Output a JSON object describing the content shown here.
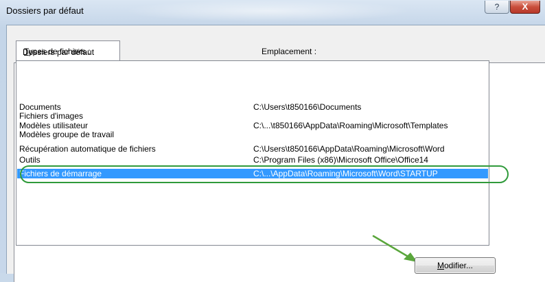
{
  "window": {
    "title": "Dossiers par défaut",
    "help_glyph": "?",
    "close_glyph": "X"
  },
  "tab": {
    "label": "Dossiers par défaut"
  },
  "columns": {
    "types_first": "T",
    "types_rest": "ypes de fichiers :",
    "location": "Emplacement :"
  },
  "list": {
    "rows": [
      {
        "name": "Documents",
        "path": "C:\\Users\\t850166\\Documents"
      },
      {
        "name": "Fichiers d'images",
        "path": ""
      },
      {
        "name": "Modèles utilisateur",
        "path": "C:\\...\\t850166\\AppData\\Roaming\\Microsoft\\Templates"
      },
      {
        "name": "Modèles groupe de travail",
        "path": ""
      },
      {
        "name": "Récupération automatique de fichiers",
        "path": "C:\\Users\\t850166\\AppData\\Roaming\\Microsoft\\Word"
      },
      {
        "name": "Outils",
        "path": "C:\\Program Files (x86)\\Microsoft Office\\Office14"
      },
      {
        "name": "Fichiers de démarrage",
        "path": "C:\\...\\AppData\\Roaming\\Microsoft\\Word\\STARTUP",
        "selected": true
      }
    ]
  },
  "buttons": {
    "modify_first": "M",
    "modify_rest": "odifier..."
  },
  "colors": {
    "selection": "#3399ff",
    "annotation_green": "#2f9a3a"
  }
}
